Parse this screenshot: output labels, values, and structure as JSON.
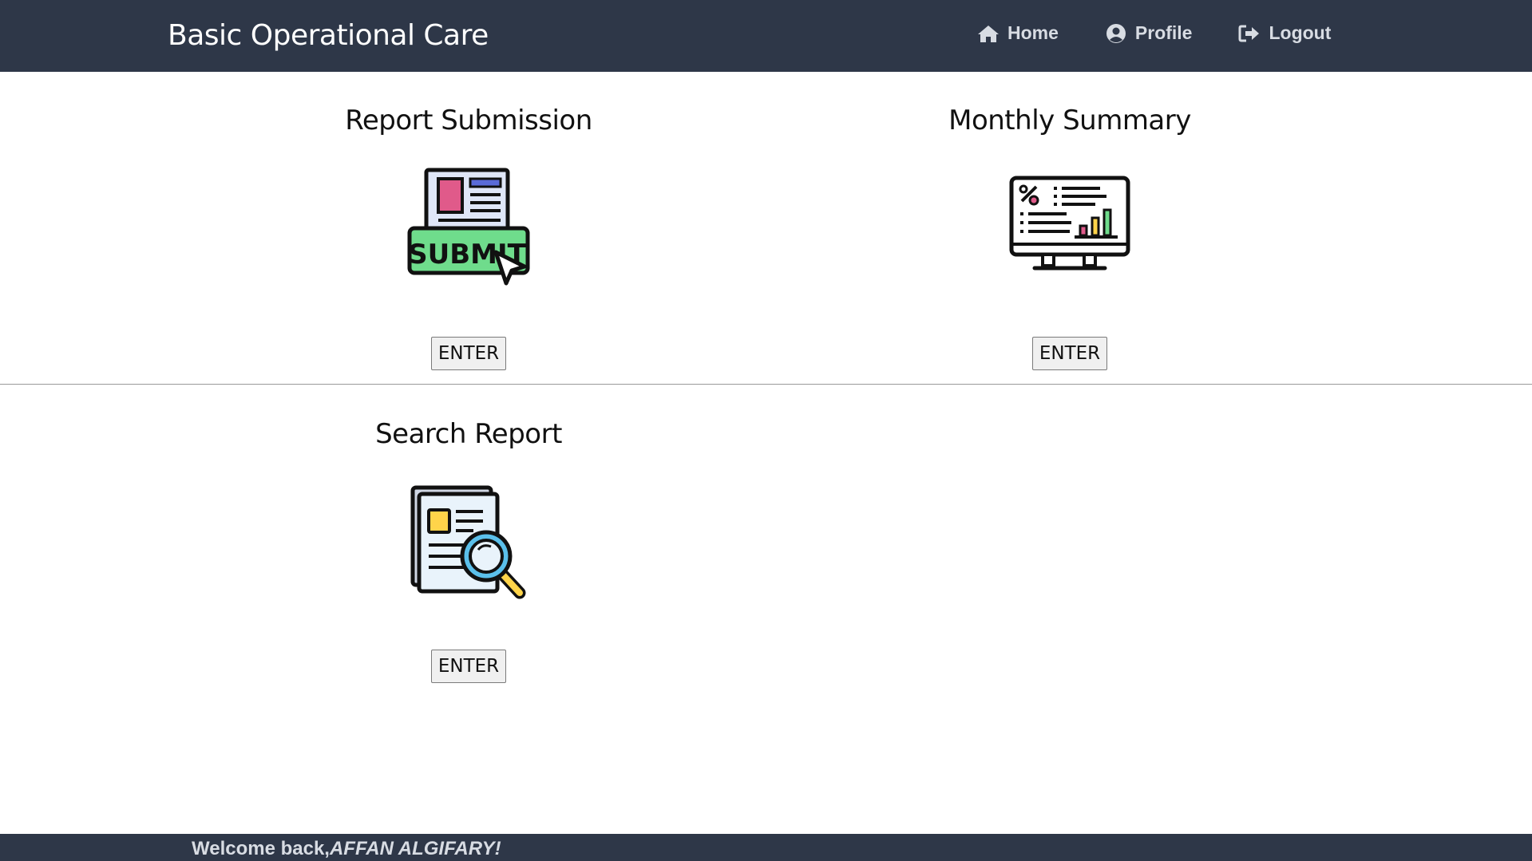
{
  "app": {
    "title": "Basic Operational Care"
  },
  "nav": {
    "items": [
      {
        "label": "Home",
        "icon": "home-icon"
      },
      {
        "label": "Profile",
        "icon": "user-circle-icon"
      },
      {
        "label": "Logout",
        "icon": "logout-icon"
      }
    ]
  },
  "cards": [
    {
      "title": "Report Submission",
      "icon": "submit-document-icon",
      "button": "ENTER"
    },
    {
      "title": "Monthly Summary",
      "icon": "monitor-chart-icon",
      "button": "ENTER"
    },
    {
      "title": "Search Report",
      "icon": "search-document-icon",
      "button": "ENTER"
    }
  ],
  "icon_text": {
    "submit": "SUBMIT"
  },
  "footer": {
    "greeting": "Welcome back,",
    "user": "AFFAN ALGIFARY!"
  },
  "colors": {
    "navbar": "#2e3748",
    "nav_text": "#d8dce3",
    "submit_green": "#6fdc8c",
    "accent_pink": "#e05a8a",
    "accent_blue": "#5a6bd8",
    "accent_yellow": "#ffd44a",
    "magnifier_blue": "#5bc0eb"
  }
}
